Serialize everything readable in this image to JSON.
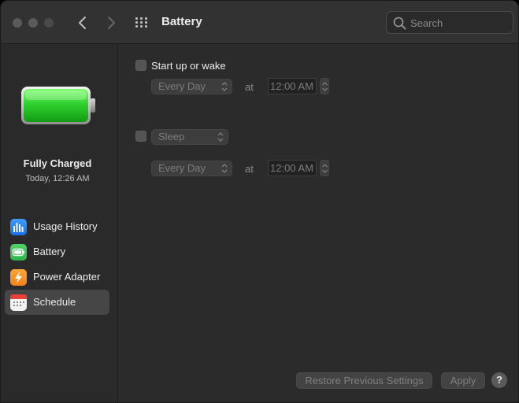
{
  "window": {
    "title": "Battery"
  },
  "search": {
    "placeholder": "Search",
    "value": ""
  },
  "sidebar": {
    "status_main": "Fully Charged",
    "status_sub": "Today, 12:26 AM",
    "items": [
      {
        "label": "Usage History",
        "icon": "bar-chart-icon",
        "selected": false
      },
      {
        "label": "Battery",
        "icon": "battery-icon",
        "selected": false
      },
      {
        "label": "Power Adapter",
        "icon": "lightning-icon",
        "selected": false
      },
      {
        "label": "Schedule",
        "icon": "calendar-icon",
        "selected": true
      }
    ]
  },
  "schedule": {
    "startup": {
      "label": "Start up or wake",
      "checked": false,
      "frequency": "Every Day",
      "at_label": "at",
      "time": "12:00 AM"
    },
    "sleep": {
      "checked": false,
      "action": "Sleep",
      "frequency": "Every Day",
      "at_label": "at",
      "time": "12:00 AM"
    }
  },
  "footer": {
    "restore_label": "Restore Previous Settings",
    "apply_label": "Apply",
    "help_label": "?"
  },
  "colors": {
    "battery_fill": "#2fd12f",
    "selected_bg": "#464646",
    "window_bg": "#2b2b2b"
  }
}
